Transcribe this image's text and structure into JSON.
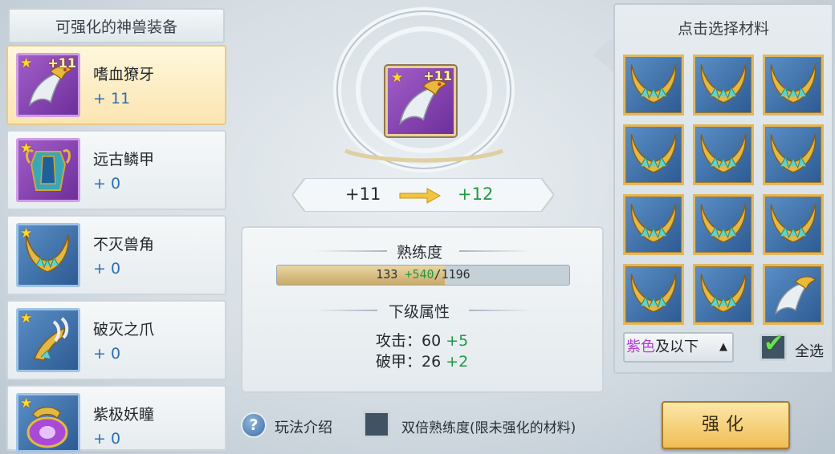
{
  "left_panel": {
    "title": "可强化的神兽装备",
    "items": [
      {
        "name": "嗜血獠牙",
        "level": "+ 11",
        "badge": "+11",
        "rarity": "purple",
        "selected": true,
        "icon": "fang-icon"
      },
      {
        "name": "远古鳞甲",
        "level": "+ 0",
        "badge": "",
        "rarity": "purple",
        "selected": false,
        "icon": "scale-armor-icon"
      },
      {
        "name": "不灭兽角",
        "level": "+ 0",
        "badge": "",
        "rarity": "blue",
        "selected": false,
        "icon": "horn-icon"
      },
      {
        "name": "破灭之爪",
        "level": "+ 0",
        "badge": "",
        "rarity": "blue",
        "selected": false,
        "icon": "claw-icon"
      },
      {
        "name": "紫极妖瞳",
        "level": "+ 0",
        "badge": "",
        "rarity": "blue",
        "selected": false,
        "icon": "demon-eye-icon"
      }
    ]
  },
  "center": {
    "slot_badge": "+11",
    "level_from": "+11",
    "level_to": "+12",
    "proficiency": {
      "title": "熟练度",
      "current": "133",
      "gain": "+540",
      "max": "/1196",
      "fill_fraction": 0.575
    },
    "next_level": {
      "title": "下级属性",
      "stats": [
        {
          "label": "攻击：60",
          "gain": "+5"
        },
        {
          "label": "破甲：26",
          "gain": "+2"
        }
      ]
    }
  },
  "bottom": {
    "help_symbol": "?",
    "help_label": "玩法介绍",
    "double_label": "双倍熟练度(限未强化的材料)"
  },
  "right_panel": {
    "title": "点击选择材料",
    "filter_color_word": "紫色",
    "filter_rest": "及以下",
    "filter_caret": "▲",
    "select_all_label": "全选",
    "select_all_checked": true,
    "materials": [
      "horn",
      "horn",
      "horn",
      "horn",
      "horn",
      "horn",
      "horn",
      "horn",
      "horn",
      "horn",
      "horn",
      "fang"
    ]
  },
  "actions": {
    "enhance_label": "强化"
  },
  "colors": {
    "purple_rarity": "#8a44b8",
    "blue_rarity": "#3f73ad",
    "gain_green": "#1f9a45",
    "level_blue": "#2b6fb5",
    "gold_frame": "#e1b75e"
  }
}
